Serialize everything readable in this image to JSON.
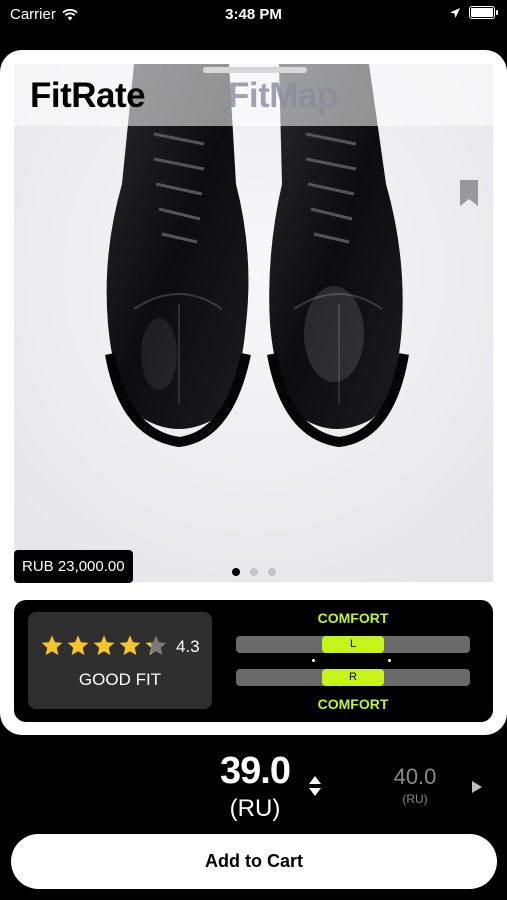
{
  "status_bar": {
    "carrier": "Carrier",
    "time": "3:48 PM",
    "battery_level": 1.0
  },
  "product": {
    "tabs": {
      "active": "FitRate",
      "inactive": "FitMap"
    },
    "image_dots": {
      "count": 3,
      "active_index": 0
    },
    "price": "RUB 23,000.00"
  },
  "fit": {
    "rating_value": "4.3",
    "rating_numeric": 4.3,
    "rating_max": 5,
    "fit_label": "GOOD FIT",
    "comfort_top_label": "COMFORT",
    "comfort_bottom_label": "COMFORT",
    "left_foot_label": "L",
    "right_foot_label": "R",
    "accent_color": "#c6f31a"
  },
  "size": {
    "current_value": "39.0",
    "current_unit": "(RU)",
    "next_value": "40.0",
    "next_unit": "(RU)"
  },
  "actions": {
    "add_to_cart_label": "Add to Cart"
  },
  "icons": {
    "wifi": "wifi-icon",
    "location": "location-arrow-icon",
    "battery": "battery-icon",
    "bookmark": "bookmark-icon",
    "stepper": "up-down-stepper-icon",
    "next": "play-arrow-icon",
    "star": "star-icon"
  }
}
